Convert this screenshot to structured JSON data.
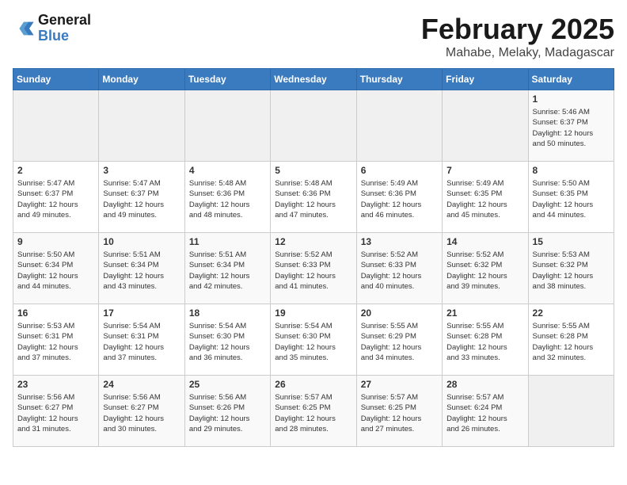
{
  "header": {
    "logo_line1": "General",
    "logo_line2": "Blue",
    "month": "February 2025",
    "location": "Mahabe, Melaky, Madagascar"
  },
  "days_of_week": [
    "Sunday",
    "Monday",
    "Tuesday",
    "Wednesday",
    "Thursday",
    "Friday",
    "Saturday"
  ],
  "weeks": [
    [
      {
        "day": "",
        "info": ""
      },
      {
        "day": "",
        "info": ""
      },
      {
        "day": "",
        "info": ""
      },
      {
        "day": "",
        "info": ""
      },
      {
        "day": "",
        "info": ""
      },
      {
        "day": "",
        "info": ""
      },
      {
        "day": "1",
        "info": "Sunrise: 5:46 AM\nSunset: 6:37 PM\nDaylight: 12 hours\nand 50 minutes."
      }
    ],
    [
      {
        "day": "2",
        "info": "Sunrise: 5:47 AM\nSunset: 6:37 PM\nDaylight: 12 hours\nand 49 minutes."
      },
      {
        "day": "3",
        "info": "Sunrise: 5:47 AM\nSunset: 6:37 PM\nDaylight: 12 hours\nand 49 minutes."
      },
      {
        "day": "4",
        "info": "Sunrise: 5:48 AM\nSunset: 6:36 PM\nDaylight: 12 hours\nand 48 minutes."
      },
      {
        "day": "5",
        "info": "Sunrise: 5:48 AM\nSunset: 6:36 PM\nDaylight: 12 hours\nand 47 minutes."
      },
      {
        "day": "6",
        "info": "Sunrise: 5:49 AM\nSunset: 6:36 PM\nDaylight: 12 hours\nand 46 minutes."
      },
      {
        "day": "7",
        "info": "Sunrise: 5:49 AM\nSunset: 6:35 PM\nDaylight: 12 hours\nand 45 minutes."
      },
      {
        "day": "8",
        "info": "Sunrise: 5:50 AM\nSunset: 6:35 PM\nDaylight: 12 hours\nand 44 minutes."
      }
    ],
    [
      {
        "day": "9",
        "info": "Sunrise: 5:50 AM\nSunset: 6:34 PM\nDaylight: 12 hours\nand 44 minutes."
      },
      {
        "day": "10",
        "info": "Sunrise: 5:51 AM\nSunset: 6:34 PM\nDaylight: 12 hours\nand 43 minutes."
      },
      {
        "day": "11",
        "info": "Sunrise: 5:51 AM\nSunset: 6:34 PM\nDaylight: 12 hours\nand 42 minutes."
      },
      {
        "day": "12",
        "info": "Sunrise: 5:52 AM\nSunset: 6:33 PM\nDaylight: 12 hours\nand 41 minutes."
      },
      {
        "day": "13",
        "info": "Sunrise: 5:52 AM\nSunset: 6:33 PM\nDaylight: 12 hours\nand 40 minutes."
      },
      {
        "day": "14",
        "info": "Sunrise: 5:52 AM\nSunset: 6:32 PM\nDaylight: 12 hours\nand 39 minutes."
      },
      {
        "day": "15",
        "info": "Sunrise: 5:53 AM\nSunset: 6:32 PM\nDaylight: 12 hours\nand 38 minutes."
      }
    ],
    [
      {
        "day": "16",
        "info": "Sunrise: 5:53 AM\nSunset: 6:31 PM\nDaylight: 12 hours\nand 37 minutes."
      },
      {
        "day": "17",
        "info": "Sunrise: 5:54 AM\nSunset: 6:31 PM\nDaylight: 12 hours\nand 37 minutes."
      },
      {
        "day": "18",
        "info": "Sunrise: 5:54 AM\nSunset: 6:30 PM\nDaylight: 12 hours\nand 36 minutes."
      },
      {
        "day": "19",
        "info": "Sunrise: 5:54 AM\nSunset: 6:30 PM\nDaylight: 12 hours\nand 35 minutes."
      },
      {
        "day": "20",
        "info": "Sunrise: 5:55 AM\nSunset: 6:29 PM\nDaylight: 12 hours\nand 34 minutes."
      },
      {
        "day": "21",
        "info": "Sunrise: 5:55 AM\nSunset: 6:28 PM\nDaylight: 12 hours\nand 33 minutes."
      },
      {
        "day": "22",
        "info": "Sunrise: 5:55 AM\nSunset: 6:28 PM\nDaylight: 12 hours\nand 32 minutes."
      }
    ],
    [
      {
        "day": "23",
        "info": "Sunrise: 5:56 AM\nSunset: 6:27 PM\nDaylight: 12 hours\nand 31 minutes."
      },
      {
        "day": "24",
        "info": "Sunrise: 5:56 AM\nSunset: 6:27 PM\nDaylight: 12 hours\nand 30 minutes."
      },
      {
        "day": "25",
        "info": "Sunrise: 5:56 AM\nSunset: 6:26 PM\nDaylight: 12 hours\nand 29 minutes."
      },
      {
        "day": "26",
        "info": "Sunrise: 5:57 AM\nSunset: 6:25 PM\nDaylight: 12 hours\nand 28 minutes."
      },
      {
        "day": "27",
        "info": "Sunrise: 5:57 AM\nSunset: 6:25 PM\nDaylight: 12 hours\nand 27 minutes."
      },
      {
        "day": "28",
        "info": "Sunrise: 5:57 AM\nSunset: 6:24 PM\nDaylight: 12 hours\nand 26 minutes."
      },
      {
        "day": "",
        "info": ""
      }
    ]
  ]
}
